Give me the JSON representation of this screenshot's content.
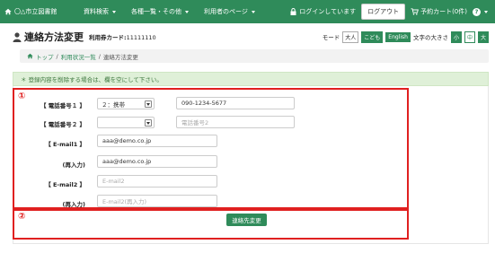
{
  "nav": {
    "brand": "〇△市立図書館",
    "menu": [
      "資料検索",
      "各種一覧・その他",
      "利用者のページ"
    ],
    "login_status": "ログインしています",
    "logout": "ログアウト",
    "cart": "予約カート(0件)",
    "help": "?"
  },
  "title": {
    "text": "連絡方法変更",
    "card_label": "利用券カード:",
    "card_number": "11111110"
  },
  "modes": {
    "mode_label": "モード",
    "large": "大人",
    "kids": "こども",
    "english": "English",
    "size_label": "文字の大きさ",
    "sizes": [
      "小",
      "中",
      "大"
    ]
  },
  "breadcrumb": {
    "top": "トップ",
    "sep": "/",
    "status": "利用状況一覧",
    "current": "連絡方法変更"
  },
  "alert": "＊ 登録内容を削除する場合は、欄を空にして下さい。",
  "markers": {
    "one": "①",
    "two": "②"
  },
  "form": {
    "phone1_label": "【 電話番号１ 】",
    "phone1_type": "２：携帯",
    "phone1_value": "090-1234-5677",
    "phone2_label": "【 電話番号２ 】",
    "phone2_type": "",
    "phone2_placeholder": "電話番号2",
    "email1_label": "【 E-mail1 】",
    "email1_value": "aaa@demo.co.jp",
    "email1_confirm_label": "(再入力)",
    "email1_confirm_value": "aaa@demo.co.jp",
    "email2_label": "【 E-mail2 】",
    "email2_placeholder": "E-mail2",
    "email2_confirm_label": "(再入力)",
    "email2_confirm_placeholder": "E-mail2(再入力)",
    "submit": "連絡先変更"
  },
  "colors": {
    "primary": "#2f8b5a",
    "highlight": "#e02020"
  }
}
